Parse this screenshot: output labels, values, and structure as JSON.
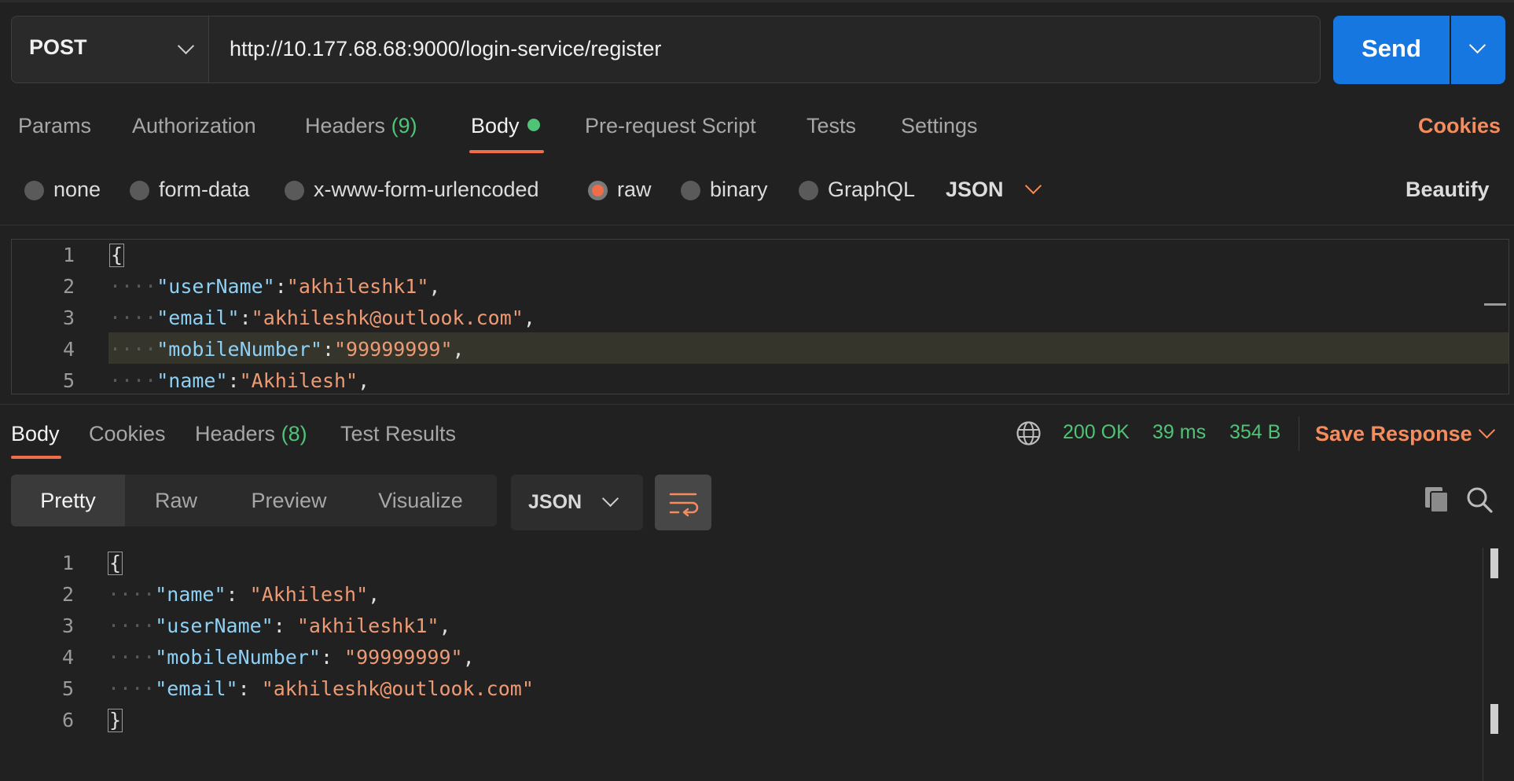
{
  "request": {
    "method": "POST",
    "url": "http://10.177.68.68:9000/login-service/register",
    "send_label": "Send"
  },
  "request_tabs": {
    "params": "Params",
    "authorization": "Authorization",
    "headers": "Headers",
    "headers_count": "(9)",
    "body": "Body",
    "pre_request": "Pre-request Script",
    "tests": "Tests",
    "settings": "Settings",
    "cookies": "Cookies"
  },
  "body_types": {
    "none": "none",
    "form_data": "form-data",
    "urlencoded": "x-www-form-urlencoded",
    "raw": "raw",
    "binary": "binary",
    "graphql": "GraphQL",
    "format": "JSON",
    "beautify": "Beautify",
    "selected": "raw"
  },
  "request_body": {
    "line_numbers": [
      "1",
      "2",
      "3",
      "4",
      "5"
    ],
    "open_brace": "{",
    "lines": [
      {
        "key": "\"userName\"",
        "sep": ":",
        "value": "\"akhileshk1\"",
        "end": ","
      },
      {
        "key": "\"email\"",
        "sep": ":",
        "value": "\"akhileshk@outlook.com\"",
        "end": ","
      },
      {
        "key": "\"mobileNumber\"",
        "sep": ":",
        "value": "\"99999999\"",
        "end": ","
      },
      {
        "key": "\"name\"",
        "sep": ":",
        "value": "\"Akhilesh\"",
        "end": ","
      }
    ]
  },
  "response_tabs": {
    "body": "Body",
    "cookies": "Cookies",
    "headers": "Headers",
    "headers_count": "(8)",
    "test_results": "Test Results"
  },
  "response_status": {
    "status": "200 OK",
    "time": "39 ms",
    "size": "354 B",
    "save_response": "Save Response"
  },
  "response_view": {
    "pretty": "Pretty",
    "raw": "Raw",
    "preview": "Preview",
    "visualize": "Visualize",
    "format": "JSON"
  },
  "response_body": {
    "line_numbers": [
      "1",
      "2",
      "3",
      "4",
      "5",
      "6"
    ],
    "open_brace": "{",
    "close_brace": "}",
    "lines": [
      {
        "key": "\"name\"",
        "sep": ": ",
        "value": "\"Akhilesh\"",
        "end": ","
      },
      {
        "key": "\"userName\"",
        "sep": ": ",
        "value": "\"akhileshk1\"",
        "end": ","
      },
      {
        "key": "\"mobileNumber\"",
        "sep": ": ",
        "value": "\"99999999\"",
        "end": ","
      },
      {
        "key": "\"email\"",
        "sep": ": ",
        "value": "\"akhileshk@outlook.com\"",
        "end": ""
      }
    ]
  },
  "colors": {
    "accent": "#ef6d48",
    "send": "#1777e0",
    "success": "#4fc476",
    "json_key": "#8fd0f5",
    "json_string": "#ee9a74"
  }
}
